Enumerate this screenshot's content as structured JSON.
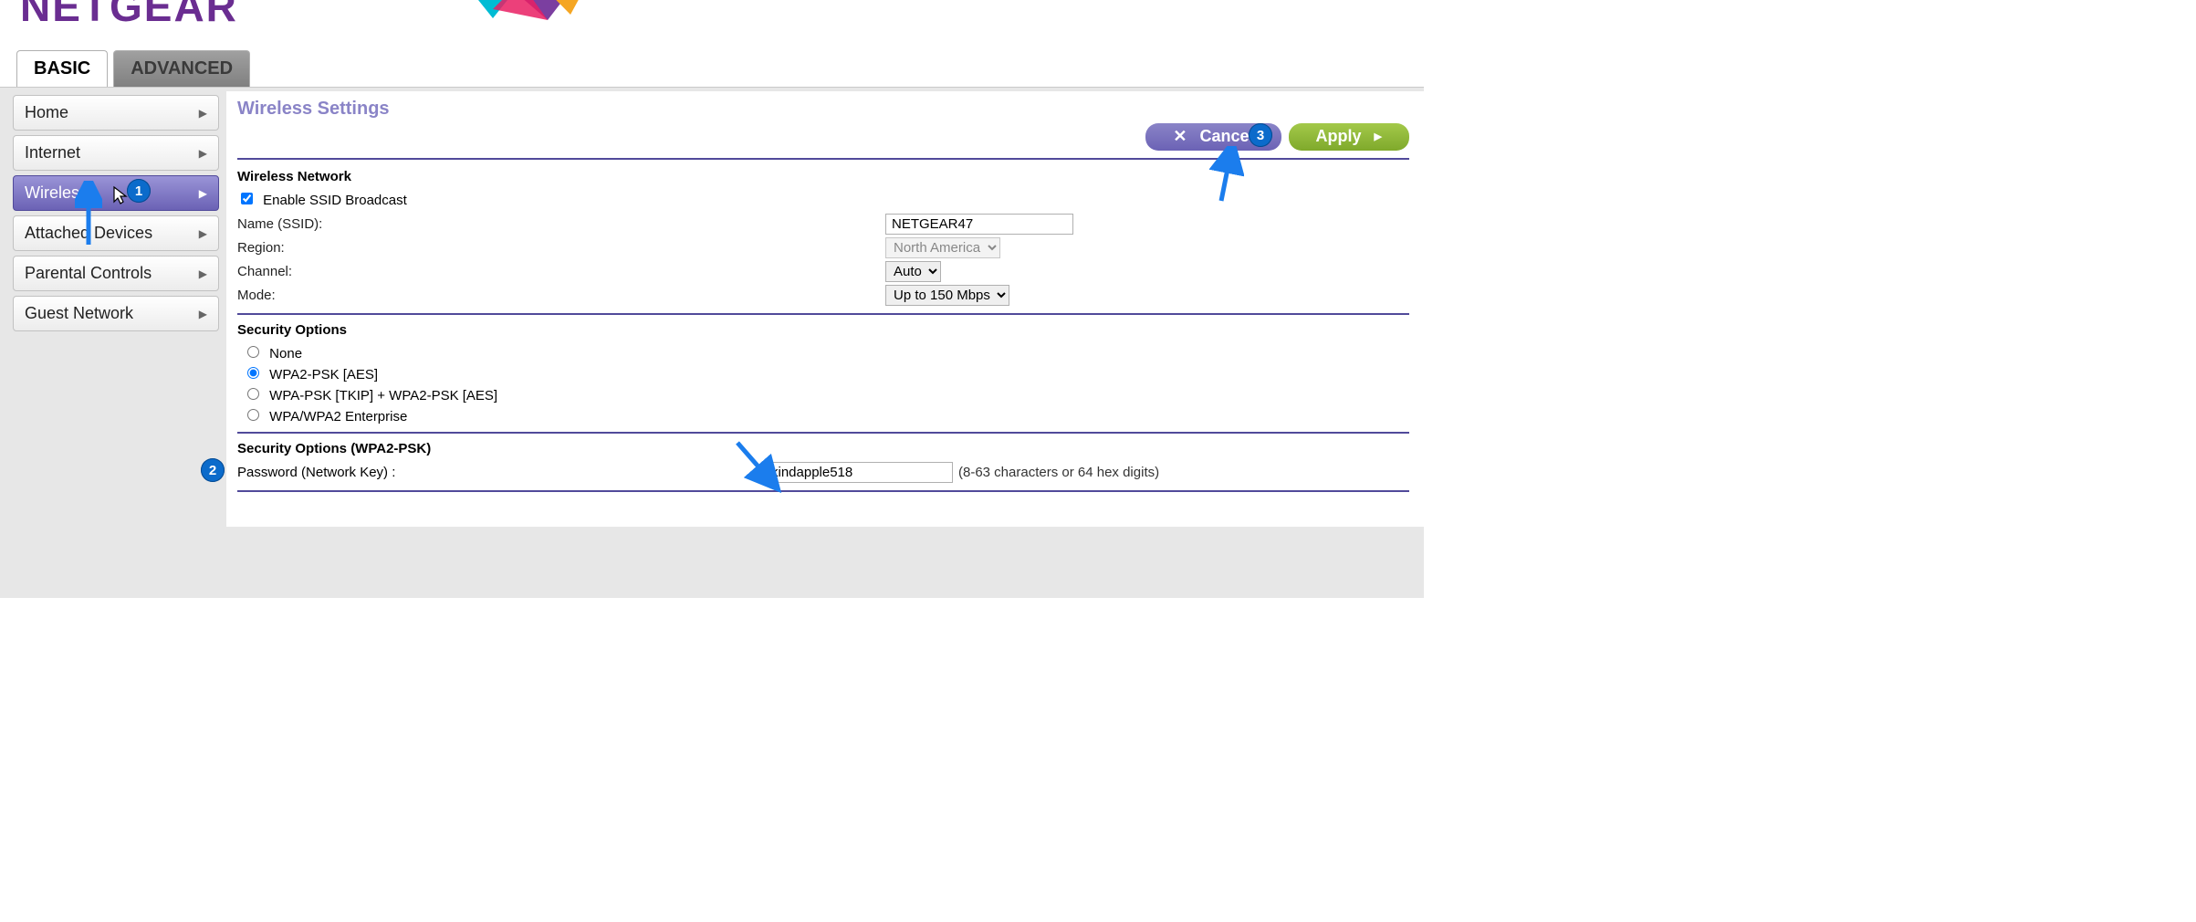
{
  "brand": "NETGEAR",
  "tabs": {
    "basic": "BASIC",
    "advanced": "ADVANCED"
  },
  "sidebar": {
    "items": [
      {
        "label": "Home"
      },
      {
        "label": "Internet"
      },
      {
        "label": "Wireless"
      },
      {
        "label": "Attached Devices"
      },
      {
        "label": "Parental Controls"
      },
      {
        "label": "Guest Network"
      }
    ]
  },
  "header": {
    "title": "Wireless Settings",
    "cancel": "Cancel",
    "apply": "Apply"
  },
  "wireless": {
    "section": "Wireless Network",
    "enable_ssid_label": "Enable SSID Broadcast",
    "name_label": "Name (SSID):",
    "name_value": "NETGEAR47",
    "region_label": "Region:",
    "region_value": "North America",
    "channel_label": "Channel:",
    "channel_value": "Auto",
    "mode_label": "Mode:",
    "mode_value": "Up to 150 Mbps"
  },
  "security": {
    "section": "Security Options",
    "options": {
      "none": "None",
      "wpa2": "WPA2-PSK [AES]",
      "mixed": "WPA-PSK [TKIP] + WPA2-PSK [AES]",
      "enterprise": "WPA/WPA2 Enterprise"
    }
  },
  "psk": {
    "section": "Security Options (WPA2-PSK)",
    "label": "Password (Network Key) :",
    "value": "kindapple518",
    "hint": "(8-63 characters or 64 hex digits)"
  },
  "annotations": {
    "b1": "1",
    "b2": "2",
    "b3": "3"
  }
}
